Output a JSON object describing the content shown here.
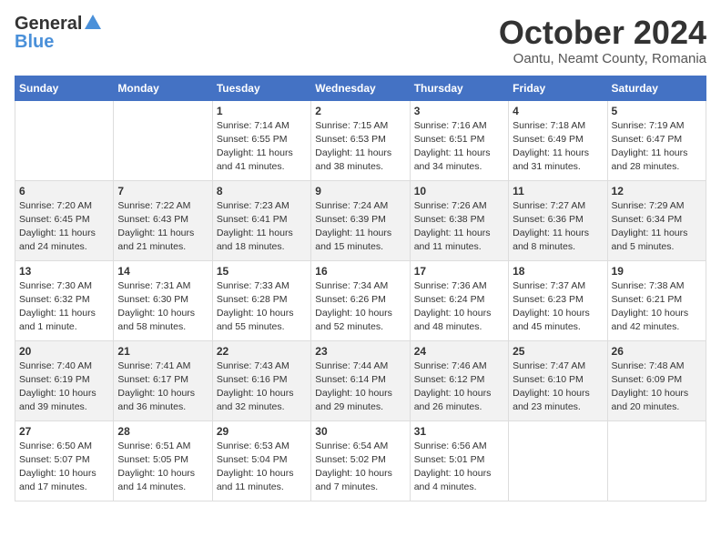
{
  "logo": {
    "general": "General",
    "blue": "Blue"
  },
  "title": "October 2024",
  "location": "Oantu, Neamt County, Romania",
  "weekdays": [
    "Sunday",
    "Monday",
    "Tuesday",
    "Wednesday",
    "Thursday",
    "Friday",
    "Saturday"
  ],
  "weeks": [
    [
      {
        "day": "",
        "info": ""
      },
      {
        "day": "",
        "info": ""
      },
      {
        "day": "1",
        "info": "Sunrise: 7:14 AM\nSunset: 6:55 PM\nDaylight: 11 hours and 41 minutes."
      },
      {
        "day": "2",
        "info": "Sunrise: 7:15 AM\nSunset: 6:53 PM\nDaylight: 11 hours and 38 minutes."
      },
      {
        "day": "3",
        "info": "Sunrise: 7:16 AM\nSunset: 6:51 PM\nDaylight: 11 hours and 34 minutes."
      },
      {
        "day": "4",
        "info": "Sunrise: 7:18 AM\nSunset: 6:49 PM\nDaylight: 11 hours and 31 minutes."
      },
      {
        "day": "5",
        "info": "Sunrise: 7:19 AM\nSunset: 6:47 PM\nDaylight: 11 hours and 28 minutes."
      }
    ],
    [
      {
        "day": "6",
        "info": "Sunrise: 7:20 AM\nSunset: 6:45 PM\nDaylight: 11 hours and 24 minutes."
      },
      {
        "day": "7",
        "info": "Sunrise: 7:22 AM\nSunset: 6:43 PM\nDaylight: 11 hours and 21 minutes."
      },
      {
        "day": "8",
        "info": "Sunrise: 7:23 AM\nSunset: 6:41 PM\nDaylight: 11 hours and 18 minutes."
      },
      {
        "day": "9",
        "info": "Sunrise: 7:24 AM\nSunset: 6:39 PM\nDaylight: 11 hours and 15 minutes."
      },
      {
        "day": "10",
        "info": "Sunrise: 7:26 AM\nSunset: 6:38 PM\nDaylight: 11 hours and 11 minutes."
      },
      {
        "day": "11",
        "info": "Sunrise: 7:27 AM\nSunset: 6:36 PM\nDaylight: 11 hours and 8 minutes."
      },
      {
        "day": "12",
        "info": "Sunrise: 7:29 AM\nSunset: 6:34 PM\nDaylight: 11 hours and 5 minutes."
      }
    ],
    [
      {
        "day": "13",
        "info": "Sunrise: 7:30 AM\nSunset: 6:32 PM\nDaylight: 11 hours and 1 minute."
      },
      {
        "day": "14",
        "info": "Sunrise: 7:31 AM\nSunset: 6:30 PM\nDaylight: 10 hours and 58 minutes."
      },
      {
        "day": "15",
        "info": "Sunrise: 7:33 AM\nSunset: 6:28 PM\nDaylight: 10 hours and 55 minutes."
      },
      {
        "day": "16",
        "info": "Sunrise: 7:34 AM\nSunset: 6:26 PM\nDaylight: 10 hours and 52 minutes."
      },
      {
        "day": "17",
        "info": "Sunrise: 7:36 AM\nSunset: 6:24 PM\nDaylight: 10 hours and 48 minutes."
      },
      {
        "day": "18",
        "info": "Sunrise: 7:37 AM\nSunset: 6:23 PM\nDaylight: 10 hours and 45 minutes."
      },
      {
        "day": "19",
        "info": "Sunrise: 7:38 AM\nSunset: 6:21 PM\nDaylight: 10 hours and 42 minutes."
      }
    ],
    [
      {
        "day": "20",
        "info": "Sunrise: 7:40 AM\nSunset: 6:19 PM\nDaylight: 10 hours and 39 minutes."
      },
      {
        "day": "21",
        "info": "Sunrise: 7:41 AM\nSunset: 6:17 PM\nDaylight: 10 hours and 36 minutes."
      },
      {
        "day": "22",
        "info": "Sunrise: 7:43 AM\nSunset: 6:16 PM\nDaylight: 10 hours and 32 minutes."
      },
      {
        "day": "23",
        "info": "Sunrise: 7:44 AM\nSunset: 6:14 PM\nDaylight: 10 hours and 29 minutes."
      },
      {
        "day": "24",
        "info": "Sunrise: 7:46 AM\nSunset: 6:12 PM\nDaylight: 10 hours and 26 minutes."
      },
      {
        "day": "25",
        "info": "Sunrise: 7:47 AM\nSunset: 6:10 PM\nDaylight: 10 hours and 23 minutes."
      },
      {
        "day": "26",
        "info": "Sunrise: 7:48 AM\nSunset: 6:09 PM\nDaylight: 10 hours and 20 minutes."
      }
    ],
    [
      {
        "day": "27",
        "info": "Sunrise: 6:50 AM\nSunset: 5:07 PM\nDaylight: 10 hours and 17 minutes."
      },
      {
        "day": "28",
        "info": "Sunrise: 6:51 AM\nSunset: 5:05 PM\nDaylight: 10 hours and 14 minutes."
      },
      {
        "day": "29",
        "info": "Sunrise: 6:53 AM\nSunset: 5:04 PM\nDaylight: 10 hours and 11 minutes."
      },
      {
        "day": "30",
        "info": "Sunrise: 6:54 AM\nSunset: 5:02 PM\nDaylight: 10 hours and 7 minutes."
      },
      {
        "day": "31",
        "info": "Sunrise: 6:56 AM\nSunset: 5:01 PM\nDaylight: 10 hours and 4 minutes."
      },
      {
        "day": "",
        "info": ""
      },
      {
        "day": "",
        "info": ""
      }
    ]
  ]
}
